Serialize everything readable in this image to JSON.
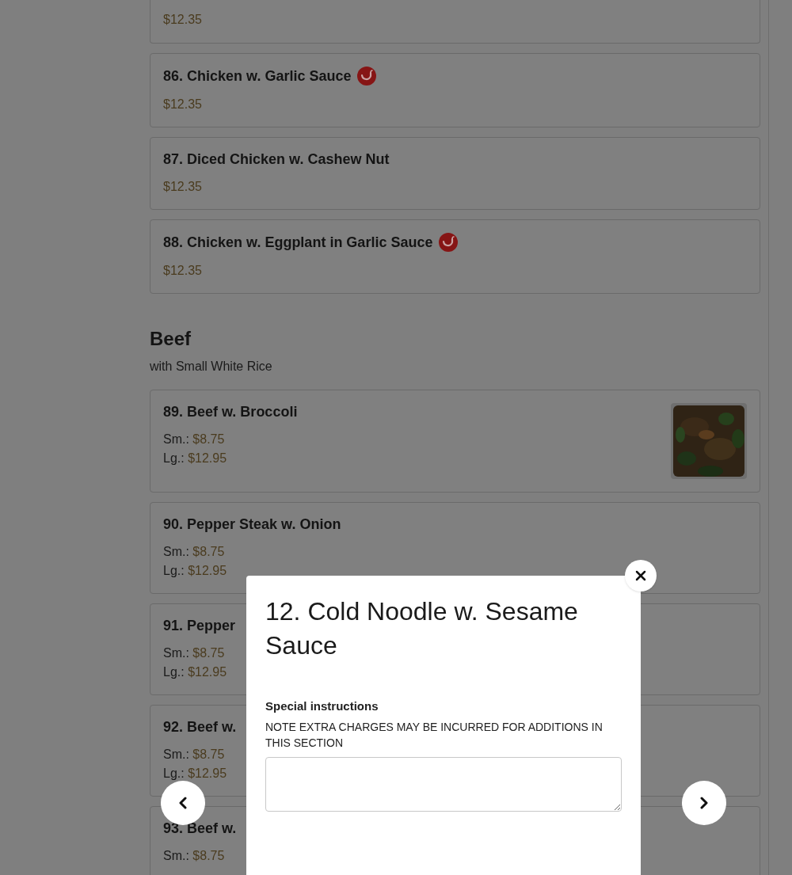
{
  "menu": {
    "sections": [
      {
        "items": [
          {
            "prices": [
              {
                "price": "$12.35"
              }
            ]
          },
          {
            "name": "86. Chicken w. Garlic Sauce",
            "spicy": true,
            "prices": [
              {
                "price": "$12.35"
              }
            ]
          },
          {
            "name": "87. Diced Chicken w. Cashew Nut",
            "spicy": false,
            "prices": [
              {
                "price": "$12.35"
              }
            ]
          },
          {
            "name": "88. Chicken w. Eggplant in Garlic Sauce",
            "spicy": true,
            "prices": [
              {
                "price": "$12.35"
              }
            ]
          }
        ]
      },
      {
        "title": "Beef",
        "subtitle": "with Small White Rice",
        "items": [
          {
            "name": "89. Beef w. Broccoli",
            "spicy": false,
            "prices": [
              {
                "label": "Sm.:",
                "price": "$8.75"
              },
              {
                "label": "Lg.:",
                "price": "$12.95"
              }
            ]
          },
          {
            "name": "90. Pepper Steak w. Onion",
            "spicy": false,
            "prices": [
              {
                "label": "Sm.:",
                "price": "$8.75"
              },
              {
                "label": "Lg.:",
                "price": "$12.95"
              }
            ]
          },
          {
            "name": "91. Pepper",
            "spicy": false,
            "prices": [
              {
                "label": "Sm.:",
                "price": "$8.75"
              },
              {
                "label": "Lg.:",
                "price": "$12.95"
              }
            ]
          },
          {
            "name": "92. Beef w.",
            "spicy": false,
            "prices": [
              {
                "label": "Sm.:",
                "price": "$8.75"
              },
              {
                "label": "Lg.:",
                "price": "$12.95"
              }
            ]
          },
          {
            "name": "93. Beef w.",
            "spicy": false,
            "prices": [
              {
                "label": "Sm.:",
                "price": "$8.75"
              }
            ]
          }
        ]
      }
    ]
  },
  "dialog": {
    "title": "12. Cold Noodle w. Sesame Sauce",
    "instructions_label": "Special instructions",
    "instructions_note": "NOTE EXTRA CHARGES MAY BE INCURRED FOR ADDITIONS IN THIS SECTION"
  }
}
